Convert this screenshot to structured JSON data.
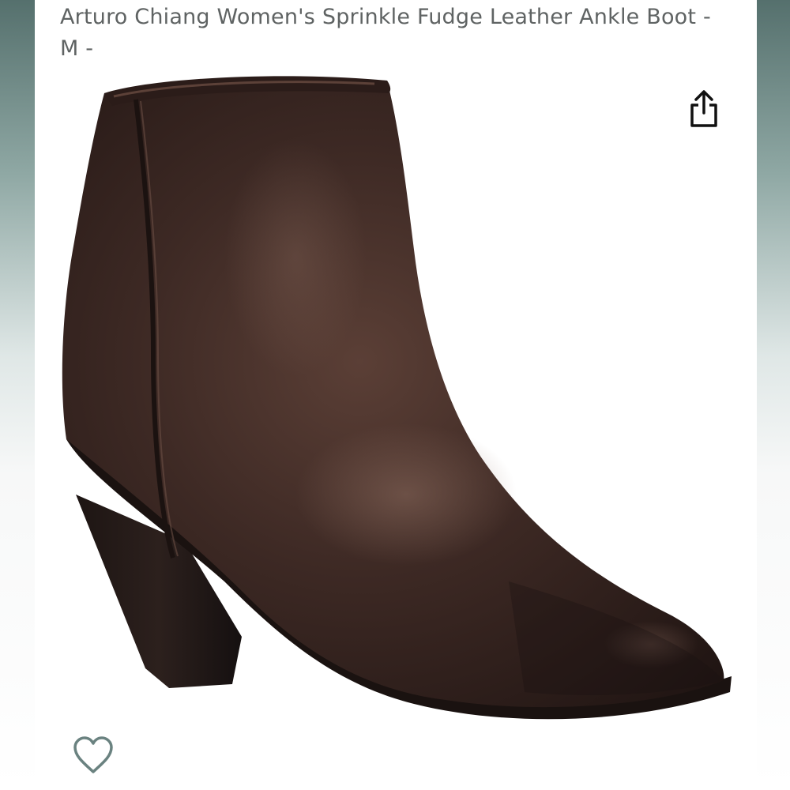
{
  "product": {
    "title": "Arturo Chiang Women's Sprinkle Fudge Leather Ankle Boot - M -"
  },
  "icons": {
    "share": "share-icon",
    "wishlist": "heart-outline-icon"
  },
  "colors": {
    "title_text": "#5f6363",
    "leather": "#3a2723",
    "heart": "#6a8280"
  }
}
